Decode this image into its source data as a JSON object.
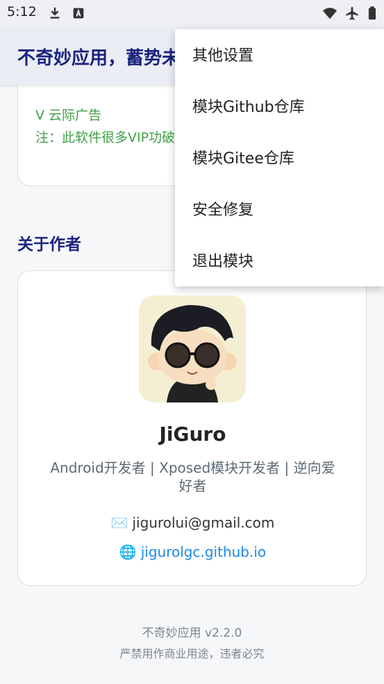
{
  "status_bar": {
    "time": "5:12",
    "left_icons": [
      "download-icon",
      "app-store-icon"
    ],
    "right_icons": [
      "wifi-icon",
      "airplane-icon",
      "battery-icon"
    ]
  },
  "app_bar": {
    "title": "不奇妙应用，蓄势未"
  },
  "top_card": {
    "clipped_line": "V 云际广告",
    "note": "注：此软件很多VIP功破解"
  },
  "about_section": {
    "title": "关于作者"
  },
  "author": {
    "avatar_icon": "cartoon-avatar",
    "name": "JiGuro",
    "description": "Android开发者 | Xposed模块开发者 | 逆向爱好者",
    "email_icon": "✉️",
    "email": "jigurolui@gmail.com",
    "site_icon": "🌐",
    "site": "jigurolgc.github.io"
  },
  "footer": {
    "version": "不奇妙应用 v2.2.0",
    "note": "严禁用作商业用途，违者必究"
  },
  "menu": {
    "items": [
      {
        "label": "其他设置"
      },
      {
        "label": "模块Github仓库"
      },
      {
        "label": "模块Gitee仓库"
      },
      {
        "label": "安全修复"
      },
      {
        "label": "退出模块"
      }
    ]
  },
  "colors": {
    "title_blue": "#1a237e",
    "note_green": "#43a047",
    "link_blue": "#1e88e5"
  }
}
